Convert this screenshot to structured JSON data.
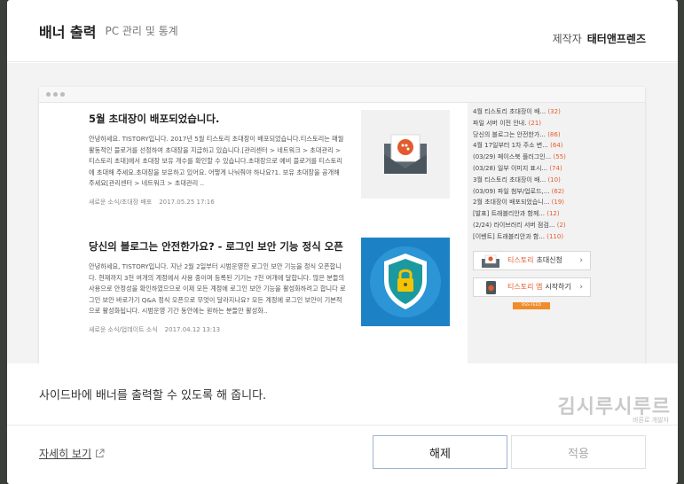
{
  "header": {
    "title": "배너 출력",
    "subtitle": "PC 관리 및 통계",
    "maker_label": "제작자",
    "maker_name": "태터앤프렌즈"
  },
  "preview": {
    "posts": [
      {
        "title": "5월 초대장이 배포되었습니다.",
        "body": "안녕하세요. TISTORY입니다. 2017년 5월 티스토리 초대장이 배포되었습니다.티스토리는 매월 활동적인 블로거를 선정하여 초대장을 지급하고 있습니다.[관리센터 > 네트워크 > 초대관리 > 티스토리 초대]에서 초대장 보유 개수를 확인할 수 있습니다.초대장으로 예비 블로거를 티스토리에 초대해 주세요.초대장을 보유하고 있어요. 어떻게 나눠줘야 하나요?1. 보유 초대장을 공개해 주세요[관리센터 > 네트워크 > 초대관리 ..",
        "category": "새로운 소식/초대장 배포",
        "date": "2017.05.25 17:16"
      },
      {
        "title": "당신의 블로그는 안전한가요? - 로그인 보안 기능 정식 오픈",
        "body": "안녕하세요, TISTORY입니다. 지난 2월 2일부터 시범운영한 로그인 보안 기능을 정식 오픈합니다. 현재까지 3천 여개의 계정에서 사용 중이며 등록된 기기는 7천 여개에 달합니다. 많은 분들의 사용으로 안정성을 확인하였으므로 이제 모든 계정에 로그인 보안 기능을 활성화하려고 합니다 로그인 보안 바로가기 Q&A 정식 오픈으로 무엇이 달라지나요? 모든 계정에 로그인 보안이 기본적으로 활성화됩니다. 시범운영 기간 동안에는 원하는 분들만 활성화..",
        "category": "새로운 소식/업데이트 소식",
        "date": "2017.04.12 13:13"
      }
    ],
    "sidebar": {
      "items": [
        {
          "text": "4월 티스토리 초대장이 배...",
          "count": "(32)"
        },
        {
          "text": "파일 서버 이전 안내.",
          "count": "(21)"
        },
        {
          "text": "당신의 블로그는 안전한가...",
          "count": "(86)"
        },
        {
          "text": "4월 17일부터 1차 주소 변...",
          "count": "(64)"
        },
        {
          "text": "(03/29) 페이스북 플러그인...",
          "count": "(55)"
        },
        {
          "text": "(03/28) 일부 이미지 표시...",
          "count": "(74)"
        },
        {
          "text": "3월 티스토리 초대장이 배...",
          "count": "(10)"
        },
        {
          "text": "(03/09) 파일 첨부/업로드,...",
          "count": "(62)"
        },
        {
          "text": "2월 초대장이 배포되었습니...",
          "count": "(19)"
        },
        {
          "text": "[발표] 트래블리안과 함께...",
          "count": "(12)"
        },
        {
          "text": "(2/24) 라이브러리 서버 점검...",
          "count": "(2)"
        },
        {
          "text": "[이벤트] 트래블리안과 함...",
          "count": "(110)"
        }
      ],
      "banner1": {
        "brand": "티스토리",
        "label": "초대신청"
      },
      "banner2": {
        "brand": "티스토리 앱",
        "label": "시작하기"
      },
      "rss": "RSS FEED"
    }
  },
  "description": "사이드바에 배너를 출력할 수 있도록 해 줍니다.",
  "watermark": {
    "main": "김시루시루르",
    "sub": "바른로 개발자"
  },
  "footer": {
    "more_link": "자세히 보기",
    "release_button": "해제",
    "apply_button": "적용"
  }
}
